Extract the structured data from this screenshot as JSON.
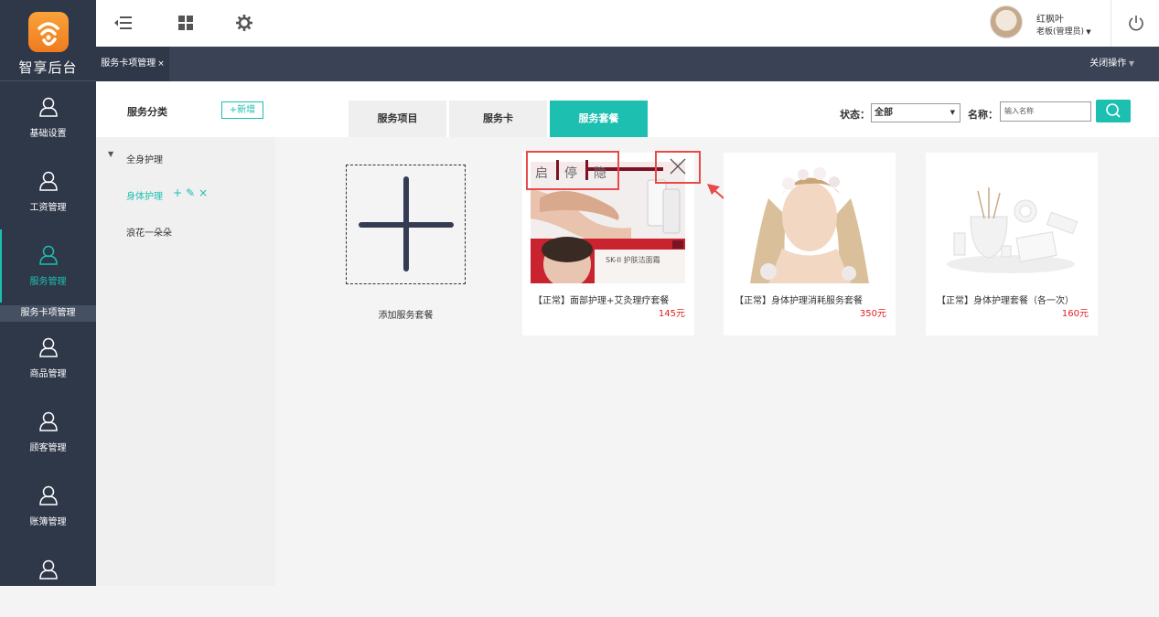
{
  "app": {
    "logo_text": "智享后台"
  },
  "sidebar": {
    "items": [
      {
        "label": "基础设置",
        "icon": "user-icon",
        "active": false
      },
      {
        "label": "工资管理",
        "icon": "user-icon",
        "active": false
      },
      {
        "label": "服务管理",
        "icon": "user-icon",
        "active": true
      },
      {
        "label": "商品管理",
        "icon": "user-icon",
        "active": false
      },
      {
        "label": "顾客管理",
        "icon": "user-icon",
        "active": false
      },
      {
        "label": "账簿管理",
        "icon": "user-icon",
        "active": false
      },
      {
        "label": "",
        "icon": "user-icon",
        "active": false
      }
    ],
    "sub_item": "服务卡项管理"
  },
  "topbar": {
    "icons": [
      "menu-collapse-icon",
      "grid-icon",
      "settings-icon"
    ],
    "user_name": "红枫叶",
    "user_role": "老板(管理员)",
    "power_icon": "power-icon"
  },
  "tabstrip": {
    "tab_label": "服务卡项管理",
    "tab_close": "×",
    "close_ops": "关闭操作"
  },
  "categories": {
    "title": "服务分类",
    "add_label": "+新增",
    "items": [
      {
        "label": "全身护理",
        "expanded": true
      },
      {
        "label": "身体护理",
        "selected": true
      },
      {
        "label": "浪花一朵朵"
      }
    ]
  },
  "tabs": [
    {
      "label": "服务项目",
      "active": false
    },
    {
      "label": "服务卡",
      "active": false
    },
    {
      "label": "服务套餐",
      "active": true
    }
  ],
  "filter": {
    "status_label": "状态：",
    "status_value": "全部",
    "name_label": "名称：",
    "name_placeholder": "输入名称"
  },
  "add_card": {
    "label": "添加服务套餐"
  },
  "controls": {
    "enable": "启",
    "stop": "停",
    "hide": "隐"
  },
  "packages": [
    {
      "name": "【正常】面部护理+艾灸理疗套餐",
      "price": "145元",
      "image_text": "SK-II 护肤洁面霜"
    },
    {
      "name": "【正常】身体护理消耗服务套餐",
      "price": "350元"
    },
    {
      "name": "【正常】身体护理套餐（各一次）",
      "price": "160元"
    }
  ],
  "colors": {
    "accent": "#1cbfb0",
    "sidebar": "#2f3849",
    "price": "#e02020",
    "highlight": "#e84a4a"
  }
}
